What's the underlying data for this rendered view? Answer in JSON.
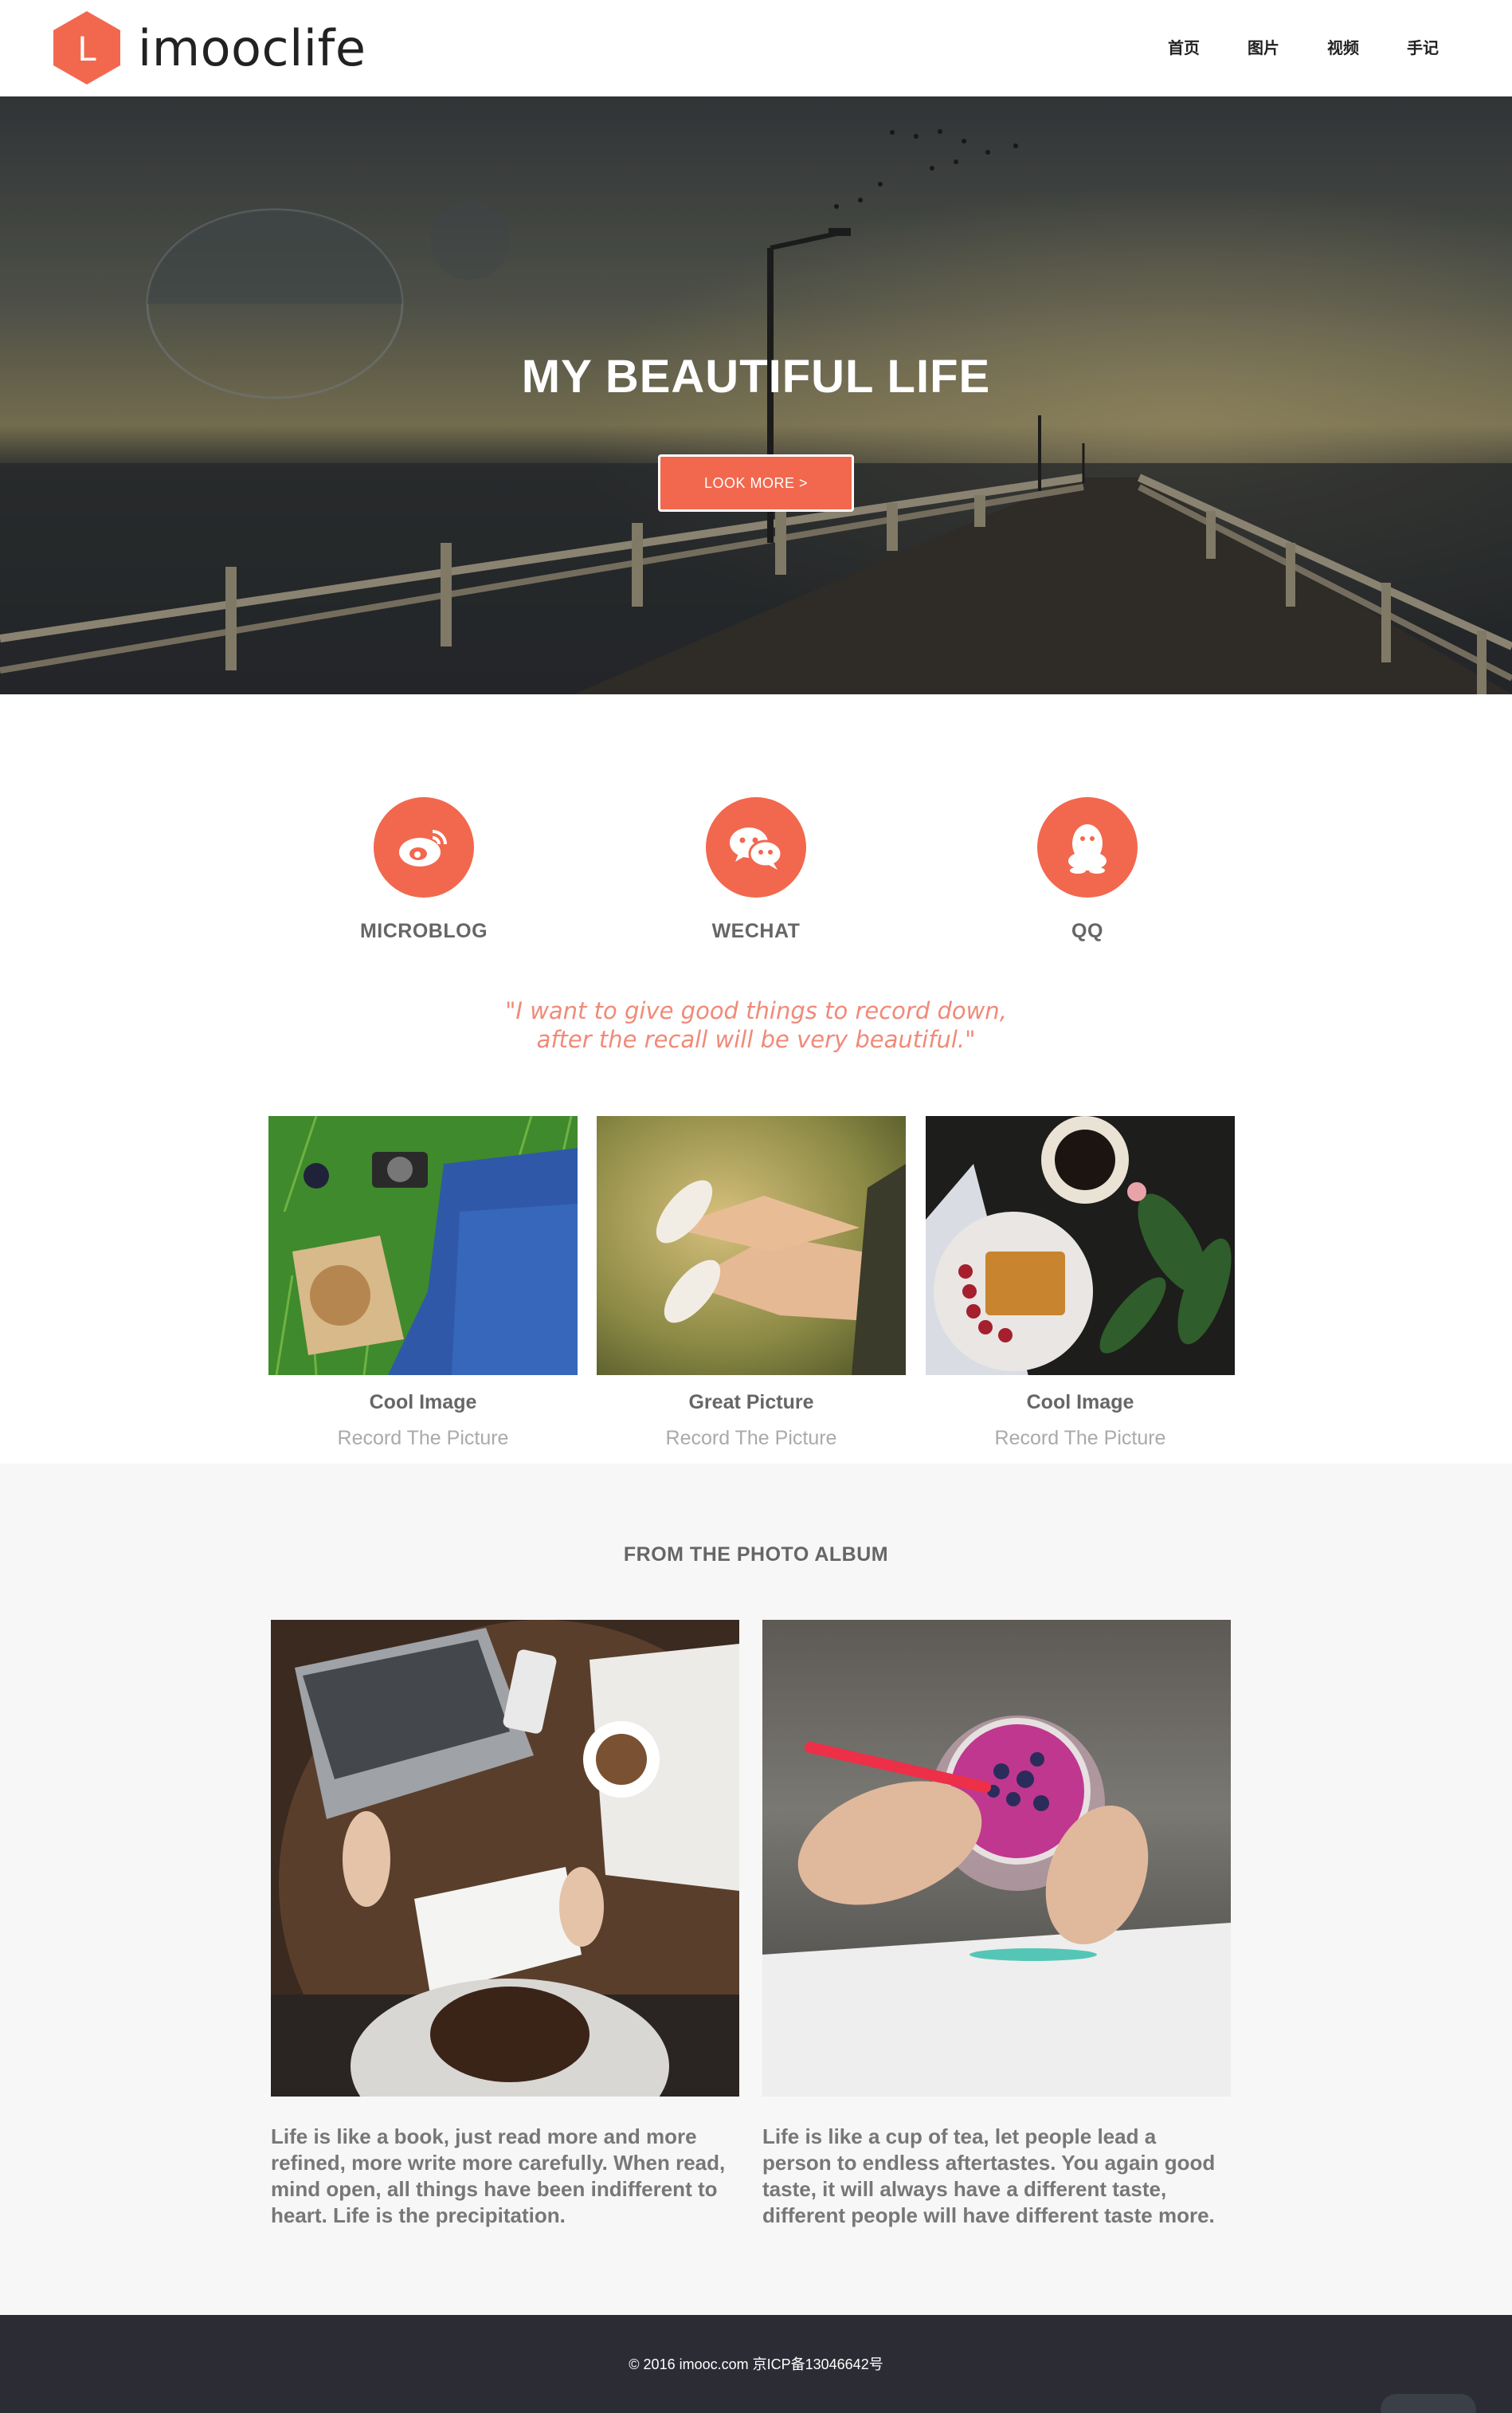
{
  "header": {
    "logo_letter": "L",
    "logo_text": "imooclife",
    "nav": [
      "首页",
      "图片",
      "视频",
      "手记"
    ]
  },
  "hero": {
    "title": "MY BEAUTIFUL LIFE",
    "button_label": "LOOK MORE  >"
  },
  "social": [
    {
      "label": "MICROBLOG",
      "icon": "weibo-icon"
    },
    {
      "label": "WECHAT",
      "icon": "wechat-icon"
    },
    {
      "label": "QQ",
      "icon": "qq-icon"
    }
  ],
  "quote": {
    "line1": "\"I want to give good things to record down,",
    "line2": "after the recall will be very beautiful.\""
  },
  "cards": [
    {
      "title": "Cool Image",
      "subtitle": "Record The Picture"
    },
    {
      "title": "Great Picture",
      "subtitle": "Record The Picture"
    },
    {
      "title": "Cool Image",
      "subtitle": "Record The Picture"
    }
  ],
  "album": {
    "title": "FROM THE PHOTO ALBUM",
    "items": [
      {
        "text": "Life is like a book, just read more and more refined, more write more carefully. When read, mind open, all things have been indifferent to heart. Life is the precipitation."
      },
      {
        "text": "Life is like a cup of tea, let people lead a person to endless aftertastes. You again good taste, it will always have a different taste, different people will have different taste more."
      }
    ]
  },
  "footer": {
    "text": "© 2016 imooc.com 京ICP备13046642号"
  },
  "colors": {
    "accent": "#f2684e",
    "footer_bg": "#2b2c34",
    "quote": "#f08a78"
  }
}
